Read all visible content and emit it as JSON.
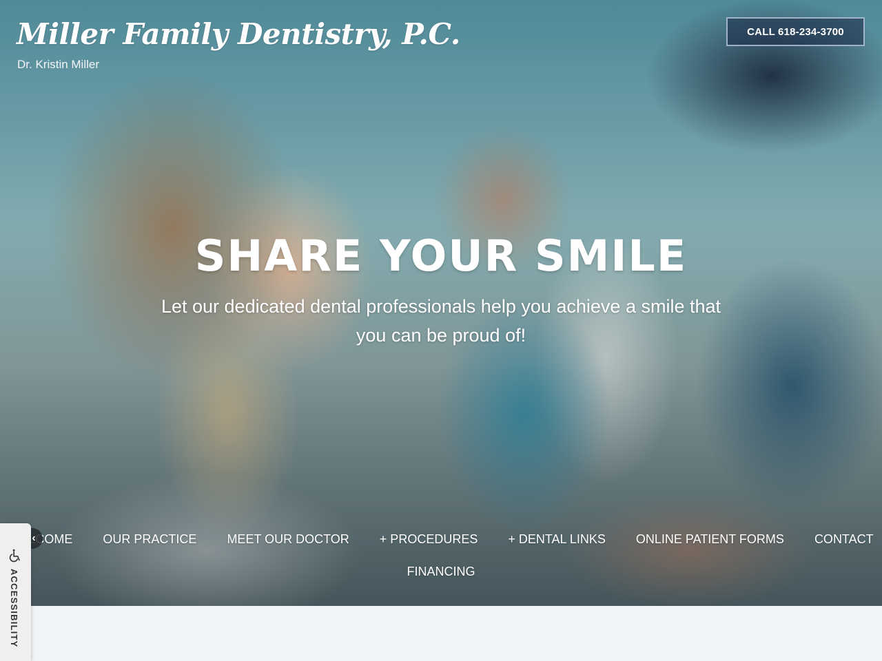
{
  "header": {
    "title": "Miller Family Dentistry, P.C.",
    "subtitle": "Dr. Kristin Miller",
    "call_button": "CALL 618-234-3700"
  },
  "hero": {
    "heading": "SHARE YOUR SMILE",
    "tagline": "Let our dedicated dental professionals help you achieve a smile that you can be proud of!"
  },
  "nav": {
    "prev_icon": "chevron-left-icon",
    "items": [
      {
        "label": "WELCOME"
      },
      {
        "label": "OUR PRACTICE"
      },
      {
        "label": "MEET OUR DOCTOR"
      },
      {
        "label": "+ PROCEDURES"
      },
      {
        "label": "+ DENTAL LINKS"
      },
      {
        "label": "ONLINE PATIENT FORMS"
      },
      {
        "label": "CONTACT"
      },
      {
        "label": "FINANCING"
      }
    ]
  },
  "accessibility": {
    "label": "ACCESSIBILITY",
    "icon": "wheelchair-icon"
  }
}
